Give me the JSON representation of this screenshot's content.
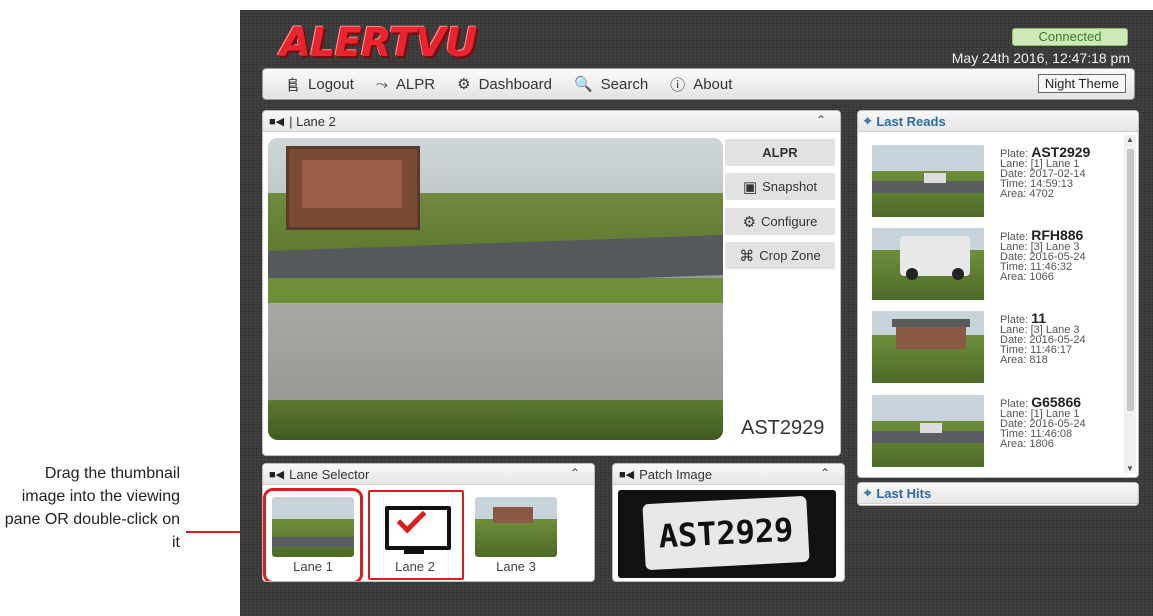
{
  "callout": {
    "text": "Drag the thumbnail image into the viewing pane OR double-click on it"
  },
  "app": {
    "logo": "ALERTVU",
    "status": "Connected",
    "datetime": "May 24th 2016, 12:47:18 pm"
  },
  "navbar": {
    "items": [
      {
        "label": "Logout",
        "icon": "logout-icon"
      },
      {
        "label": "ALPR",
        "icon": "camera-icon"
      },
      {
        "label": "Dashboard",
        "icon": "gears-icon"
      },
      {
        "label": "Search",
        "icon": "search-icon"
      },
      {
        "label": "About",
        "icon": "info-icon"
      }
    ],
    "night_theme": "Night Theme"
  },
  "video_panel": {
    "title": "| Lane 2",
    "buttons": {
      "alpr": "ALPR",
      "snapshot": "Snapshot",
      "configure": "Configure",
      "crop_zone": "Crop Zone"
    },
    "plate": "AST2929"
  },
  "lane_selector": {
    "title": "Lane Selector",
    "lanes": [
      {
        "label": "Lane 1"
      },
      {
        "label": "Lane 2"
      },
      {
        "label": "Lane 3"
      }
    ]
  },
  "patch_panel": {
    "title": "Patch Image",
    "plate_text": "AST2929"
  },
  "last_reads": {
    "title": "Last Reads",
    "items": [
      {
        "plate_prefix": "Plate:",
        "plate": "AST2929",
        "lane": "Lane: [1] Lane 1",
        "date": "Date: 2017-02-14",
        "time": "Time: 14:59:13",
        "area": "Area: 4702"
      },
      {
        "plate_prefix": "Plate:",
        "plate": "RFH886",
        "lane": "Lane: [3] Lane 3",
        "date": "Date: 2016-05-24",
        "time": "Time: 11:46:32",
        "area": "Area: 1066"
      },
      {
        "plate_prefix": "Plate:",
        "plate": "11",
        "lane": "Lane: [3] Lane 3",
        "date": "Date: 2016-05-24",
        "time": "Time: 11:46:17",
        "area": "Area: 818"
      },
      {
        "plate_prefix": "Plate:",
        "plate": "G65866",
        "lane": "Lane: [1] Lane 1",
        "date": "Date: 2016-05-24",
        "time": "Time: 11:46:08",
        "area": "Area: 1806"
      }
    ]
  },
  "last_hits": {
    "title": "Last Hits"
  },
  "colors": {
    "accent_red": "#d81e1e",
    "connected_green": "#3f7d23",
    "link_blue": "#2d6aa6"
  }
}
